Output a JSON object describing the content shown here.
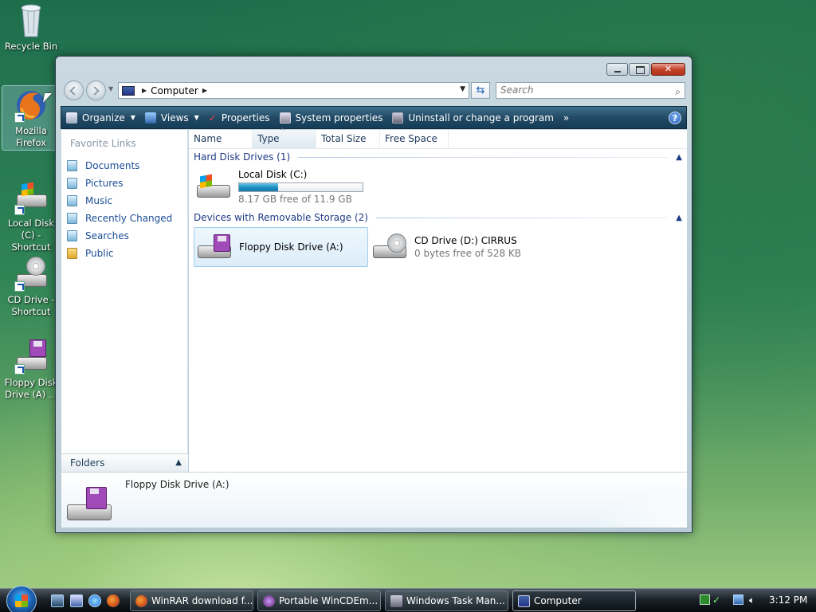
{
  "desktop": {
    "icons": [
      {
        "label": "Recycle Bin"
      },
      {
        "label": "Mozilla Firefox"
      },
      {
        "label": "Local Disk (C) - Shortcut"
      },
      {
        "label": "CD Drive - Shortcut"
      },
      {
        "label": "Floppy Disk Drive (A) ..."
      }
    ]
  },
  "window": {
    "address": {
      "crumb": "Computer"
    },
    "search": {
      "placeholder": "Search"
    },
    "toolbar": {
      "organize": "Organize",
      "views": "Views",
      "properties": "Properties",
      "system_properties": "System properties",
      "uninstall": "Uninstall or change a program",
      "more": "»"
    },
    "left_pane": {
      "title": "Favorite Links",
      "links": [
        "Documents",
        "Pictures",
        "Music",
        "Recently Changed",
        "Searches",
        "Public"
      ],
      "folders": "Folders"
    },
    "columns": [
      "Name",
      "Type",
      "Total Size",
      "Free Space"
    ],
    "groups": [
      {
        "title": "Hard Disk Drives (1)"
      },
      {
        "title": "Devices with Removable Storage (2)"
      }
    ],
    "drives": {
      "c": {
        "name": "Local Disk (C:)",
        "free": "8.17 GB free of 11.9 GB",
        "used_fraction": 0.314
      },
      "a": {
        "name": "Floppy Disk Drive (A:)"
      },
      "d": {
        "name": "CD Drive (D:) CIRRUS",
        "free": "0 bytes free of 528 KB"
      }
    },
    "details": {
      "title": "Floppy Disk Drive (A:)"
    }
  },
  "taskbar": {
    "tasks": [
      "WinRAR download f...",
      "Portable WinCDEm...",
      "Windows Task Man...",
      "Computer"
    ],
    "clock": "3:12 PM"
  },
  "colors": {
    "accent": "#1d90c2",
    "toolbar": "#224a64"
  }
}
